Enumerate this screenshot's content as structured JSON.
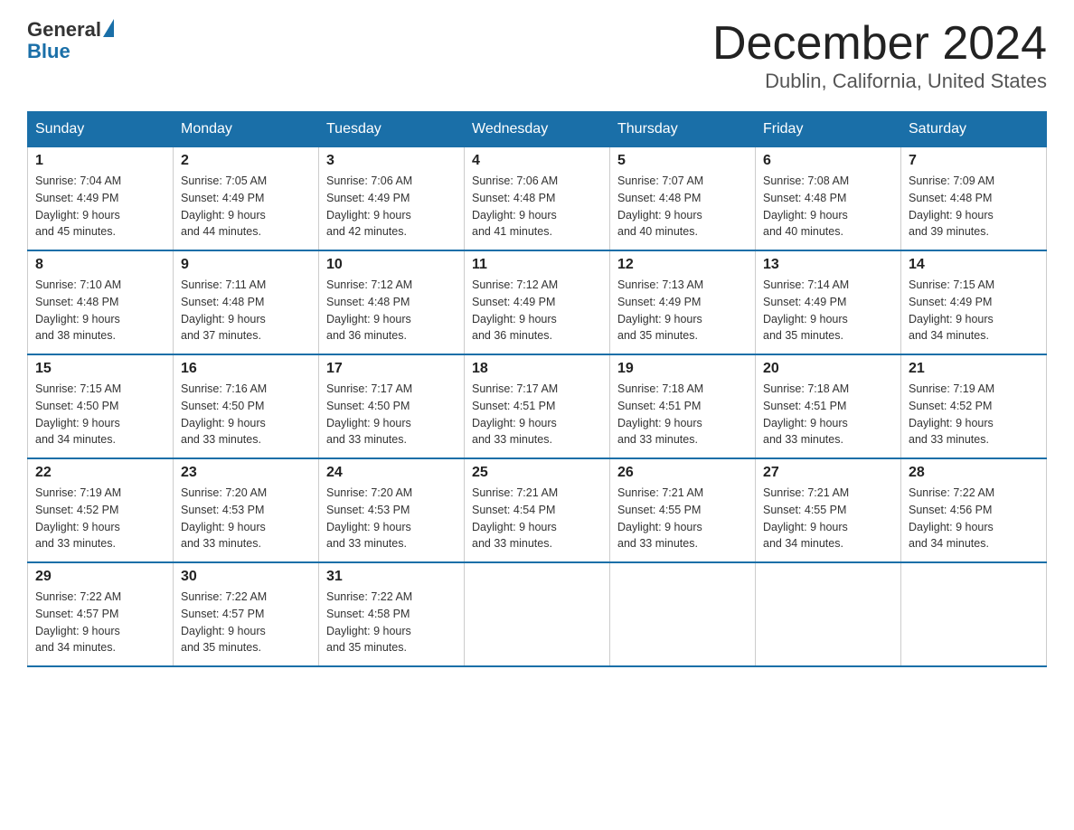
{
  "header": {
    "logo_general": "General",
    "logo_blue": "Blue",
    "month_title": "December 2024",
    "location": "Dublin, California, United States"
  },
  "days_of_week": [
    "Sunday",
    "Monday",
    "Tuesday",
    "Wednesday",
    "Thursday",
    "Friday",
    "Saturday"
  ],
  "weeks": [
    [
      {
        "day": "1",
        "sunrise": "7:04 AM",
        "sunset": "4:49 PM",
        "daylight": "9 hours and 45 minutes."
      },
      {
        "day": "2",
        "sunrise": "7:05 AM",
        "sunset": "4:49 PM",
        "daylight": "9 hours and 44 minutes."
      },
      {
        "day": "3",
        "sunrise": "7:06 AM",
        "sunset": "4:49 PM",
        "daylight": "9 hours and 42 minutes."
      },
      {
        "day": "4",
        "sunrise": "7:06 AM",
        "sunset": "4:48 PM",
        "daylight": "9 hours and 41 minutes."
      },
      {
        "day": "5",
        "sunrise": "7:07 AM",
        "sunset": "4:48 PM",
        "daylight": "9 hours and 40 minutes."
      },
      {
        "day": "6",
        "sunrise": "7:08 AM",
        "sunset": "4:48 PM",
        "daylight": "9 hours and 40 minutes."
      },
      {
        "day": "7",
        "sunrise": "7:09 AM",
        "sunset": "4:48 PM",
        "daylight": "9 hours and 39 minutes."
      }
    ],
    [
      {
        "day": "8",
        "sunrise": "7:10 AM",
        "sunset": "4:48 PM",
        "daylight": "9 hours and 38 minutes."
      },
      {
        "day": "9",
        "sunrise": "7:11 AM",
        "sunset": "4:48 PM",
        "daylight": "9 hours and 37 minutes."
      },
      {
        "day": "10",
        "sunrise": "7:12 AM",
        "sunset": "4:48 PM",
        "daylight": "9 hours and 36 minutes."
      },
      {
        "day": "11",
        "sunrise": "7:12 AM",
        "sunset": "4:49 PM",
        "daylight": "9 hours and 36 minutes."
      },
      {
        "day": "12",
        "sunrise": "7:13 AM",
        "sunset": "4:49 PM",
        "daylight": "9 hours and 35 minutes."
      },
      {
        "day": "13",
        "sunrise": "7:14 AM",
        "sunset": "4:49 PM",
        "daylight": "9 hours and 35 minutes."
      },
      {
        "day": "14",
        "sunrise": "7:15 AM",
        "sunset": "4:49 PM",
        "daylight": "9 hours and 34 minutes."
      }
    ],
    [
      {
        "day": "15",
        "sunrise": "7:15 AM",
        "sunset": "4:50 PM",
        "daylight": "9 hours and 34 minutes."
      },
      {
        "day": "16",
        "sunrise": "7:16 AM",
        "sunset": "4:50 PM",
        "daylight": "9 hours and 33 minutes."
      },
      {
        "day": "17",
        "sunrise": "7:17 AM",
        "sunset": "4:50 PM",
        "daylight": "9 hours and 33 minutes."
      },
      {
        "day": "18",
        "sunrise": "7:17 AM",
        "sunset": "4:51 PM",
        "daylight": "9 hours and 33 minutes."
      },
      {
        "day": "19",
        "sunrise": "7:18 AM",
        "sunset": "4:51 PM",
        "daylight": "9 hours and 33 minutes."
      },
      {
        "day": "20",
        "sunrise": "7:18 AM",
        "sunset": "4:51 PM",
        "daylight": "9 hours and 33 minutes."
      },
      {
        "day": "21",
        "sunrise": "7:19 AM",
        "sunset": "4:52 PM",
        "daylight": "9 hours and 33 minutes."
      }
    ],
    [
      {
        "day": "22",
        "sunrise": "7:19 AM",
        "sunset": "4:52 PM",
        "daylight": "9 hours and 33 minutes."
      },
      {
        "day": "23",
        "sunrise": "7:20 AM",
        "sunset": "4:53 PM",
        "daylight": "9 hours and 33 minutes."
      },
      {
        "day": "24",
        "sunrise": "7:20 AM",
        "sunset": "4:53 PM",
        "daylight": "9 hours and 33 minutes."
      },
      {
        "day": "25",
        "sunrise": "7:21 AM",
        "sunset": "4:54 PM",
        "daylight": "9 hours and 33 minutes."
      },
      {
        "day": "26",
        "sunrise": "7:21 AM",
        "sunset": "4:55 PM",
        "daylight": "9 hours and 33 minutes."
      },
      {
        "day": "27",
        "sunrise": "7:21 AM",
        "sunset": "4:55 PM",
        "daylight": "9 hours and 34 minutes."
      },
      {
        "day": "28",
        "sunrise": "7:22 AM",
        "sunset": "4:56 PM",
        "daylight": "9 hours and 34 minutes."
      }
    ],
    [
      {
        "day": "29",
        "sunrise": "7:22 AM",
        "sunset": "4:57 PM",
        "daylight": "9 hours and 34 minutes."
      },
      {
        "day": "30",
        "sunrise": "7:22 AM",
        "sunset": "4:57 PM",
        "daylight": "9 hours and 35 minutes."
      },
      {
        "day": "31",
        "sunrise": "7:22 AM",
        "sunset": "4:58 PM",
        "daylight": "9 hours and 35 minutes."
      },
      null,
      null,
      null,
      null
    ]
  ],
  "labels": {
    "sunrise": "Sunrise:",
    "sunset": "Sunset:",
    "daylight": "Daylight:"
  }
}
